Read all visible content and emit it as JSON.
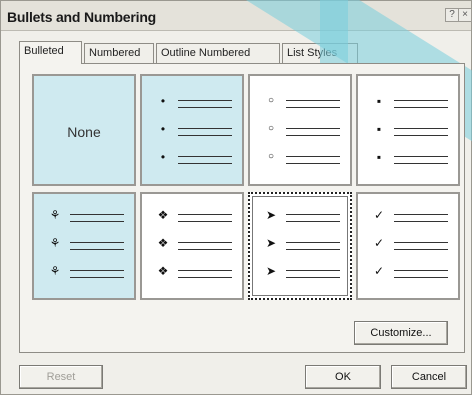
{
  "window": {
    "title": "Bullets and Numbering",
    "help_glyph": "?",
    "close_glyph": "×"
  },
  "tabs": [
    {
      "label": "Bulleted",
      "active": true
    },
    {
      "label": "Numbered",
      "active": false
    },
    {
      "label": "Outline Numbered",
      "active": false
    },
    {
      "label": "List Styles",
      "active": false
    }
  ],
  "gallery": {
    "none_label": "None",
    "selected_index": 6,
    "options": [
      {
        "icon": "none",
        "glyph": ""
      },
      {
        "icon": "filled-circle-bullet-icon",
        "glyph": "•"
      },
      {
        "icon": "hollow-circle-bullet-icon",
        "glyph": "○"
      },
      {
        "icon": "filled-square-bullet-icon",
        "glyph": "▪"
      },
      {
        "icon": "feather-bullet-icon",
        "glyph": "⚘"
      },
      {
        "icon": "four-diamond-bullet-icon",
        "glyph": "❖"
      },
      {
        "icon": "arrowhead-bullet-icon",
        "glyph": "➤"
      },
      {
        "icon": "checkmark-bullet-icon",
        "glyph": "✓"
      }
    ]
  },
  "buttons": {
    "customize": "Customize...",
    "reset": "Reset",
    "ok": "OK",
    "cancel": "Cancel"
  }
}
